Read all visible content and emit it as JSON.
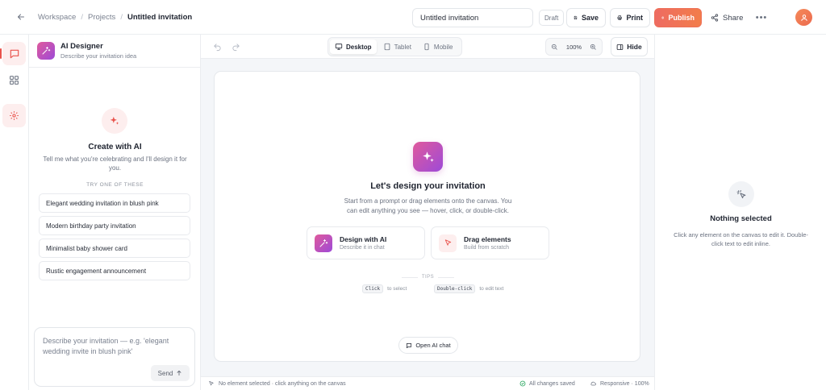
{
  "header": {
    "breadcrumbs": [
      "Workspace",
      "Projects",
      "Untitled invitation"
    ],
    "title_value": "Untitled invitation",
    "status": "Draft",
    "save_label": "Save",
    "print_label": "Print",
    "publish_label": "Publish",
    "share_label": "Share"
  },
  "ai_panel": {
    "title": "AI Designer",
    "subtitle": "Describe your invitation idea",
    "empty_title": "Create with AI",
    "empty_desc": "Tell me what you're celebrating and I'll design it for you.",
    "try_label": "TRY ONE OF THESE",
    "suggestions": [
      "Elegant wedding invitation in blush pink",
      "Modern birthday party invitation",
      "Minimalist baby shower card",
      "Rustic engagement announcement"
    ],
    "composer_placeholder": "Describe your invitation — e.g. 'elegant wedding invite in blush pink'",
    "send_label": "Send"
  },
  "canvas_toolbar": {
    "devices": [
      "Desktop",
      "Tablet",
      "Mobile"
    ],
    "active_device": "Desktop",
    "zoom": "100%",
    "hide_label": "Hide"
  },
  "canvas": {
    "title": "Let's design your invitation",
    "desc": "Start from a prompt or drag elements onto the canvas. You can edit anything you see — hover, click, or double-click.",
    "choices": [
      {
        "title": "Design with AI",
        "sub": "Describe it in chat"
      },
      {
        "title": "Drag elements",
        "sub": "Build from scratch"
      }
    ],
    "tips_label": "TIPS",
    "hints": [
      {
        "key": "Click",
        "text": "to select"
      },
      {
        "key": "Double-click",
        "text": "to edit text"
      }
    ],
    "open_chat_label": "Open AI chat"
  },
  "status_bar": {
    "selection": "No element selected · click anything on the canvas",
    "saved": "All changes saved",
    "responsive": "Responsive · 100%"
  },
  "properties": {
    "title": "Nothing selected",
    "desc": "Click any element on the canvas to edit it. Double-click text to edit inline."
  },
  "colors": {
    "accent": "#e9534c",
    "publish_gradient_start": "#ee6b62",
    "publish_gradient_end": "#f27d4a",
    "ai_gradient_start": "#e05a9c",
    "ai_gradient_end": "#9d4ad8",
    "success": "#22a35a"
  },
  "icons": {
    "back": "arrow-left-icon",
    "save": "save-icon",
    "print": "printer-icon",
    "publish": "globe-icon",
    "share": "share-icon",
    "more": "more-horizontal-icon",
    "avatar": "user-icon",
    "rail": [
      "chat-icon",
      "grid-icon",
      "gear-icon"
    ],
    "ai": "sparkles-icon",
    "pointer": "cursor-icon"
  }
}
